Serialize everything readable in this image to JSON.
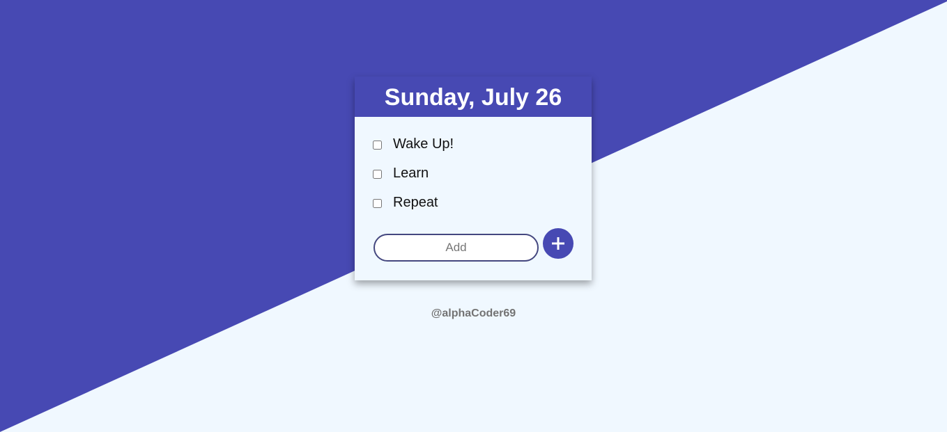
{
  "header": {
    "date_title": "Sunday, July 26"
  },
  "tasks": [
    {
      "label": "Wake Up!",
      "checked": false
    },
    {
      "label": "Learn",
      "checked": false
    },
    {
      "label": "Repeat",
      "checked": false
    }
  ],
  "add_form": {
    "placeholder": "Add",
    "value": "",
    "button_icon": "plus-icon"
  },
  "footer": {
    "credit": "@alphaCoder69"
  },
  "colors": {
    "accent": "#4749b3",
    "background": "#f0f8ff",
    "input_border": "#44477f",
    "credit_text": "#737373"
  }
}
